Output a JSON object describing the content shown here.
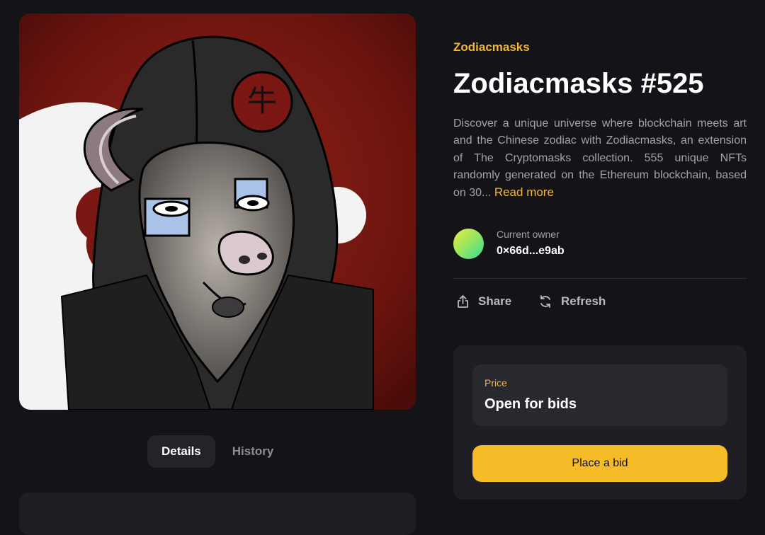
{
  "nft": {
    "collection": "Zodiacmasks",
    "title": "Zodiacmasks #525",
    "description": "Discover a unique universe where blockchain meets art and the Chinese zodiac with Zodiacmasks, an extension of The Cryptomasks collection. 555 unique NFTs randomly generated on the Ethereum blockchain, based on 30...",
    "read_more": "Read more",
    "artwork_glyph": "牛"
  },
  "owner": {
    "label": "Current owner",
    "address": "0×66d...e9ab"
  },
  "actions": {
    "share": "Share",
    "share_icon": "share-icon",
    "refresh": "Refresh",
    "refresh_icon": "refresh-icon"
  },
  "price": {
    "label": "Price",
    "value": "Open for bids"
  },
  "bid_button": "Place a bid",
  "tabs": [
    {
      "label": "Details",
      "active": true
    },
    {
      "label": "History",
      "active": false
    }
  ],
  "colors": {
    "accent": "#f2b632",
    "button": "#f5bc27",
    "background": "#141418",
    "card": "#1e1e24"
  }
}
